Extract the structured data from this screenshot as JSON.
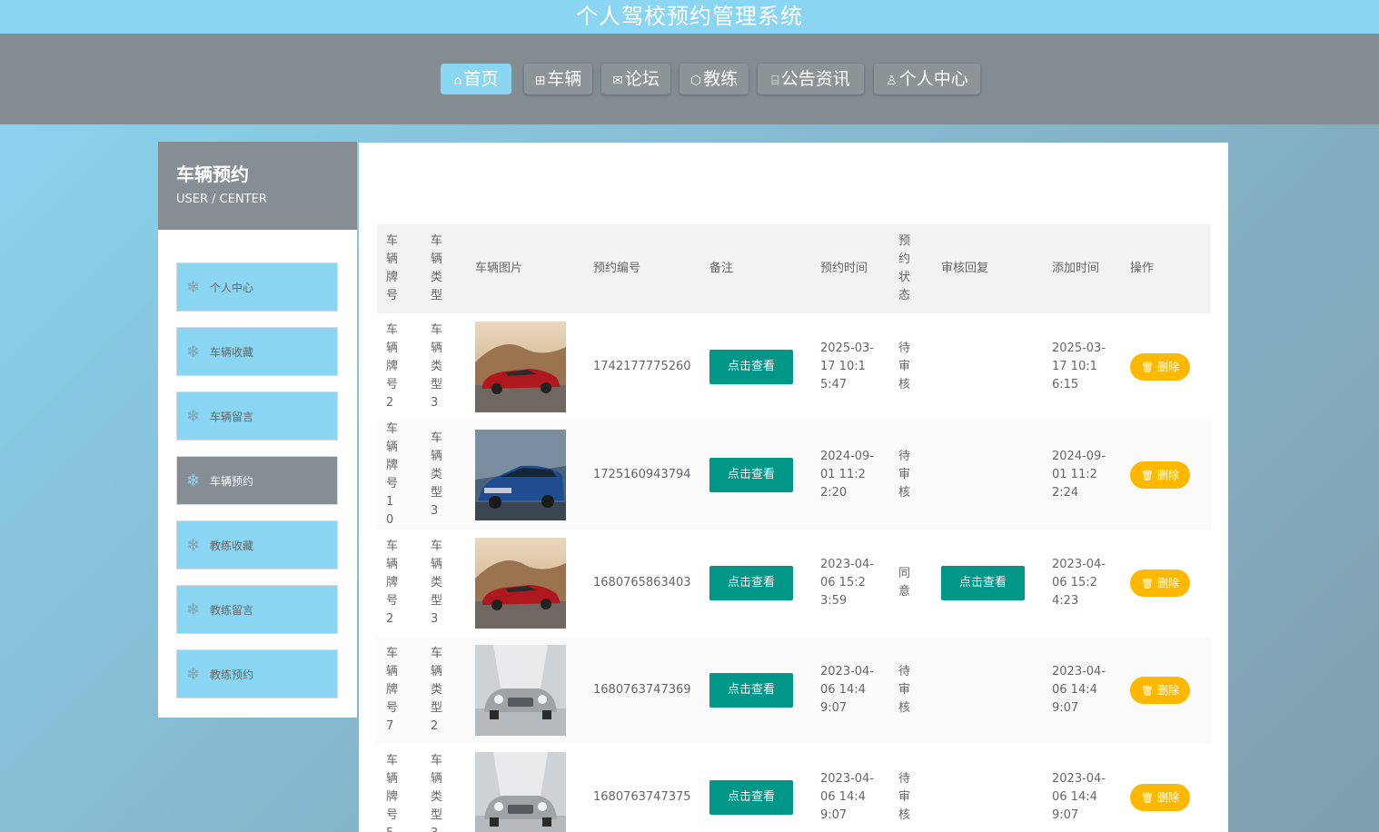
{
  "app": {
    "title": "个人驾校预约管理系统"
  },
  "nav": [
    {
      "label": "首页",
      "icon": "home-icon",
      "glyph": "⌂",
      "active": true
    },
    {
      "label": "车辆",
      "icon": "gift-icon",
      "glyph": "⊞",
      "active": false
    },
    {
      "label": "论坛",
      "icon": "mail-icon",
      "glyph": "✉",
      "active": false
    },
    {
      "label": "教练",
      "icon": "cube-icon",
      "glyph": "⬡",
      "active": false
    },
    {
      "label": "公告资讯",
      "icon": "news-icon",
      "glyph": "⌸",
      "active": false
    },
    {
      "label": "个人中心",
      "icon": "user-icon",
      "glyph": "♙",
      "active": false
    }
  ],
  "sidebar": {
    "title": "车辆预约",
    "subtitle": "USER / CENTER",
    "items": [
      {
        "label": "个人中心",
        "active": false
      },
      {
        "label": "车辆收藏",
        "active": false
      },
      {
        "label": "车辆留言",
        "active": false
      },
      {
        "label": "车辆预约",
        "active": true
      },
      {
        "label": "教练收藏",
        "active": false
      },
      {
        "label": "教练留言",
        "active": false
      },
      {
        "label": "教练预约",
        "active": false
      }
    ]
  },
  "table": {
    "headers": [
      "车辆牌号",
      "车辆类型",
      "车辆图片",
      "预约编号",
      "备注",
      "预约时间",
      "预约状态",
      "审核回复",
      "添加时间",
      "操作"
    ],
    "view_label": "点击查看",
    "delete_label": "删除",
    "rows": [
      {
        "plate": "车辆牌号2",
        "type": "车辆类型3",
        "image": "red-sedan",
        "no": "1742177775260",
        "time": "2025-03-17 10:15:47",
        "status": "待审核",
        "reply": "",
        "added": "2025-03-17 10:16:15"
      },
      {
        "plate": "车辆牌号10",
        "type": "车辆类型3",
        "image": "blue-wagon",
        "no": "1725160943794",
        "time": "2024-09-01 11:22:20",
        "status": "待审核",
        "reply": "",
        "added": "2024-09-01 11:22:24"
      },
      {
        "plate": "车辆牌号2",
        "type": "车辆类型3",
        "image": "red-sedan",
        "no": "1680765863403",
        "time": "2023-04-06 15:23:59",
        "status": "同意",
        "reply": "点击查看",
        "added": "2023-04-06 15:24:23"
      },
      {
        "plate": "车辆牌号7",
        "type": "车辆类型2",
        "image": "silver-convertible",
        "no": "1680763747369",
        "time": "2023-04-06 14:49:07",
        "status": "待审核",
        "reply": "",
        "added": "2023-04-06 14:49:07"
      },
      {
        "plate": "车辆牌号5",
        "type": "车辆类型3",
        "image": "silver-convertible",
        "no": "1680763747375",
        "time": "2023-04-06 14:49:07",
        "status": "待审核",
        "reply": "",
        "added": "2023-04-06 14:49:07"
      }
    ]
  },
  "colors": {
    "accent": "#8ad6f2",
    "nav_bg": "#838c91",
    "view_button": "#009688",
    "delete_button": "#ffb800"
  }
}
